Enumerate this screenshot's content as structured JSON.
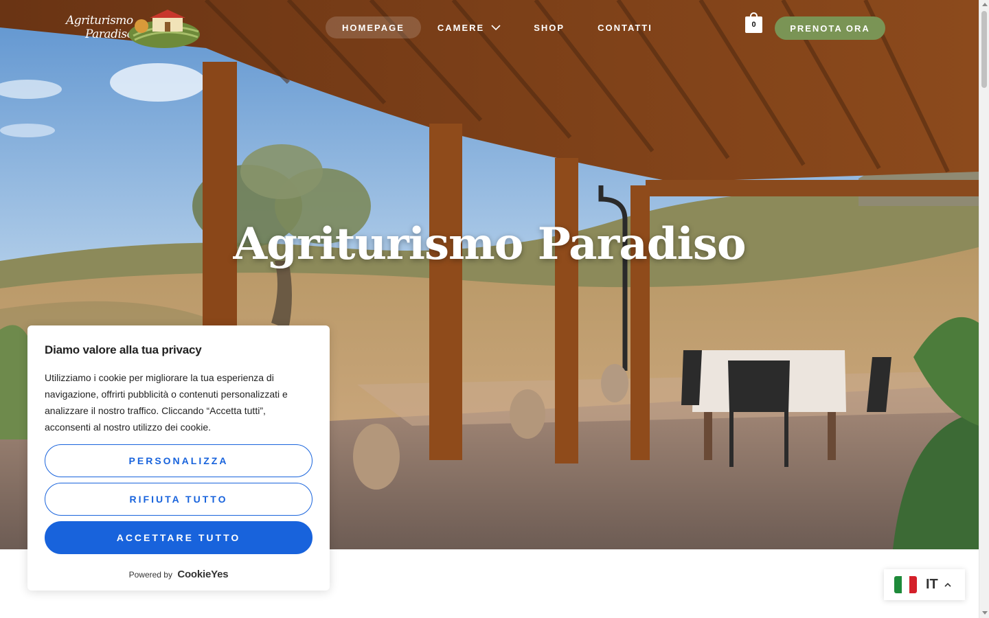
{
  "brand": {
    "logo_line1": "Agriturismo",
    "logo_line2": "Paradiso"
  },
  "nav": {
    "items": [
      {
        "label": "HOMEPAGE",
        "active": true
      },
      {
        "label": "CAMERE",
        "dropdown": true
      },
      {
        "label": "SHOP"
      },
      {
        "label": "CONTATTI"
      }
    ]
  },
  "cart": {
    "count": "0"
  },
  "cta": {
    "book_label": "PRENOTA ORA",
    "color": "#7a9455"
  },
  "hero": {
    "title": "Agriturismo Paradiso"
  },
  "cookie_banner": {
    "title": "Diamo valore alla tua privacy",
    "text": "Utilizziamo i cookie per migliorare la tua esperienza di navigazione, offrirti pubblicità o contenuti personalizzati e analizzare il nostro traffico. Cliccando “Accetta tutti”, acconsenti al nostro utilizzo dei cookie.",
    "customize_label": "PERSONALIZZA",
    "reject_label": "RIFIUTA TUTTO",
    "accept_label": "ACCETTARE TUTTO",
    "powered_by": "Powered by",
    "powered_brand": "CookieYes",
    "accent_color": "#1863dc"
  },
  "language": {
    "code": "IT",
    "flag": "italy-flag-icon"
  }
}
